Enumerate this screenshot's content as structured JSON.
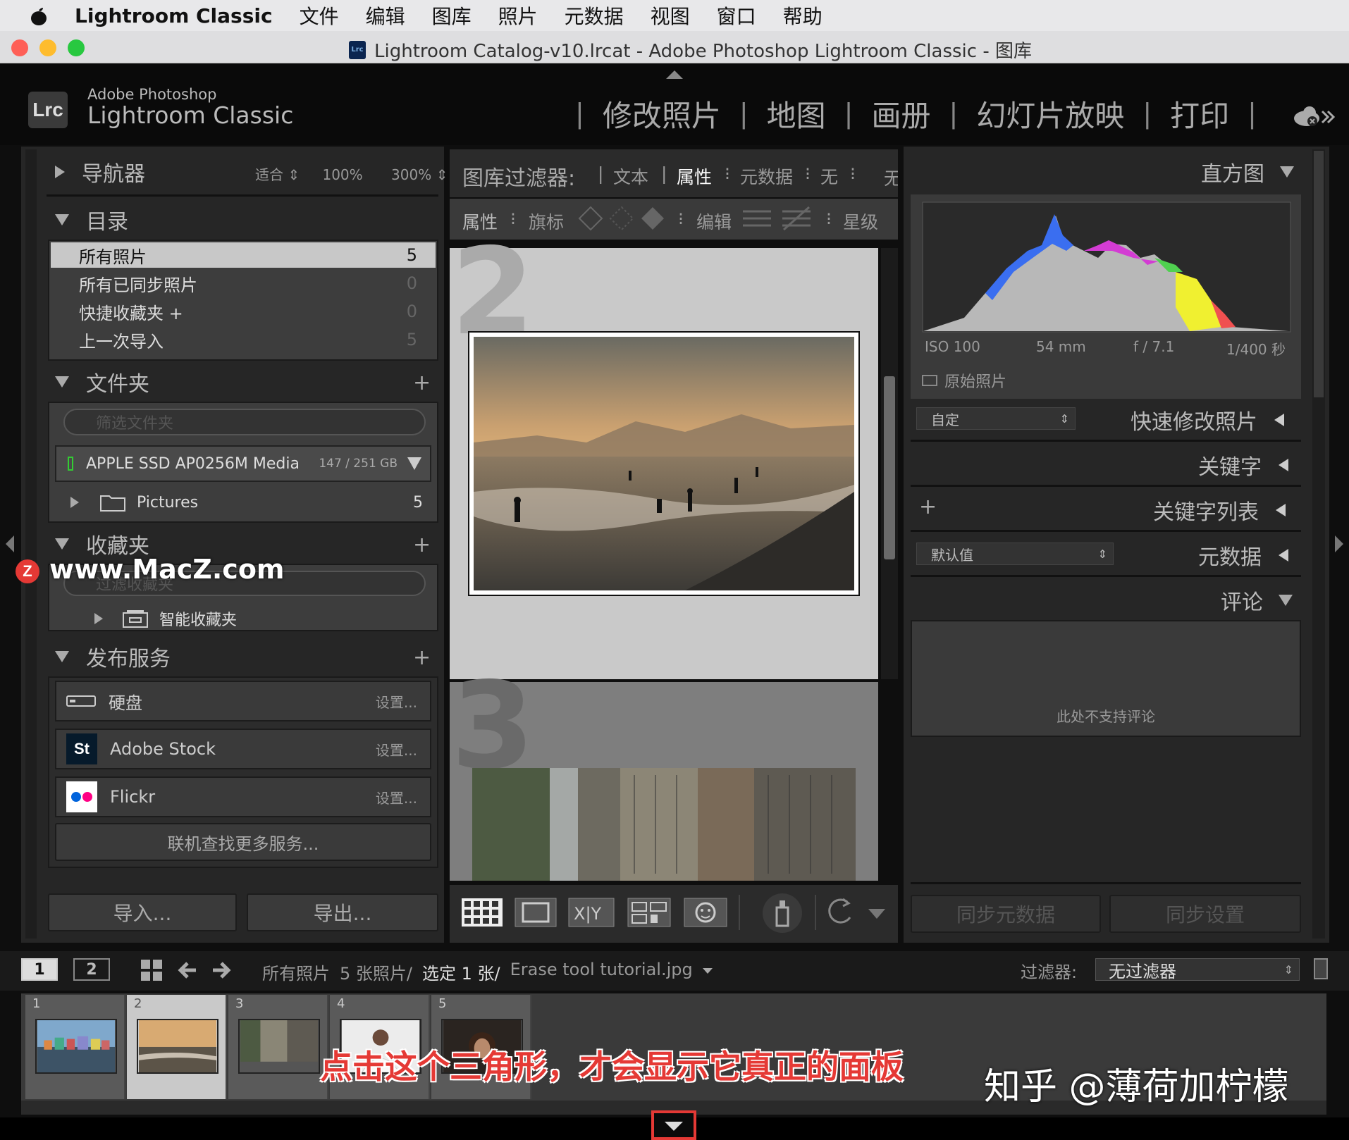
{
  "menubar": {
    "app_name": "Lightroom Classic",
    "items": [
      "文件",
      "编辑",
      "图库",
      "照片",
      "元数据",
      "视图",
      "窗口",
      "帮助"
    ]
  },
  "window": {
    "title": "Lightroom Catalog-v10.lrcat - Adobe Photoshop Lightroom Classic - 图库",
    "icon_text": "Lrc"
  },
  "branding": {
    "logo": "Lrc",
    "line1": "Adobe Photoshop",
    "line2": "Lightroom Classic"
  },
  "modules": [
    "修改照片",
    "地图",
    "画册",
    "幻灯片放映",
    "打印"
  ],
  "left": {
    "navigator": {
      "title": "导航器",
      "fit": "适合",
      "z100": "100%",
      "z300": "300%"
    },
    "catalog": {
      "title": "目录",
      "items": [
        {
          "label": "所有照片",
          "count": "5"
        },
        {
          "label": "所有已同步照片",
          "count": "0"
        },
        {
          "label": "快捷收藏夹 +",
          "count": "0"
        },
        {
          "label": "上一次导入",
          "count": "5"
        }
      ]
    },
    "folders": {
      "title": "文件夹",
      "filter_placeholder": "筛选文件夹",
      "volume": "APPLE SSD AP0256M Media",
      "volume_size": "147 / 251 GB",
      "folder": "Pictures",
      "folder_count": "5"
    },
    "collections": {
      "title": "收藏夹",
      "filter_placeholder": "过滤收藏夹",
      "smart": "智能收藏夹"
    },
    "publish": {
      "title": "发布服务",
      "services": [
        {
          "name": "硬盘",
          "action": "设置..."
        },
        {
          "name": "Adobe Stock",
          "action": "设置..."
        },
        {
          "name": "Flickr",
          "action": "设置..."
        }
      ],
      "find_more": "联机查找更多服务..."
    },
    "import_label": "导入...",
    "export_label": "导出..."
  },
  "filterbar": {
    "title": "图库过滤器:",
    "tabs": [
      "文本",
      "属性",
      "元数据",
      "无"
    ],
    "right_cut": "无",
    "attr_label": "属性",
    "flag_label": "旗标",
    "edit_label": "编辑",
    "rating_label": "星级"
  },
  "grid": {
    "cell_numbers": [
      "2",
      "3"
    ]
  },
  "right": {
    "histogram": {
      "title": "直方图",
      "iso": "ISO 100",
      "focal": "54 mm",
      "aperture": "f / 7.1",
      "shutter": "1/400 秒",
      "original": "原始照片"
    },
    "quick_develop": {
      "preset": "自定",
      "title": "快速修改照片"
    },
    "keywording": {
      "title": "关键字"
    },
    "keyword_list": {
      "title": "关键字列表"
    },
    "metadata": {
      "preset": "默认值",
      "title": "元数据"
    },
    "comments": {
      "title": "评论",
      "message": "此处不支持评论"
    },
    "sync_metadata": "同步元数据",
    "sync_settings": "同步设置"
  },
  "statusbar": {
    "view1": "1",
    "view2": "2",
    "path": "所有照片",
    "count": "5 张照片/",
    "selected": "选定 1 张/",
    "filename": "Erase tool tutorial.jpg",
    "filter_label": "过滤器:",
    "filter_value": "无过滤器"
  },
  "filmstrip": {
    "numbers": [
      "1",
      "2",
      "3",
      "4",
      "5"
    ]
  },
  "watermarks": {
    "site": "www.MacZ.com",
    "annotation": "点击这个三角形，才会显示它真正的面板",
    "credit": "知乎 @薄荷加柠檬"
  },
  "colors": {
    "accent_red": "#e53935",
    "selected_row": "#c8c8c8",
    "panel_bg": "#262626"
  }
}
